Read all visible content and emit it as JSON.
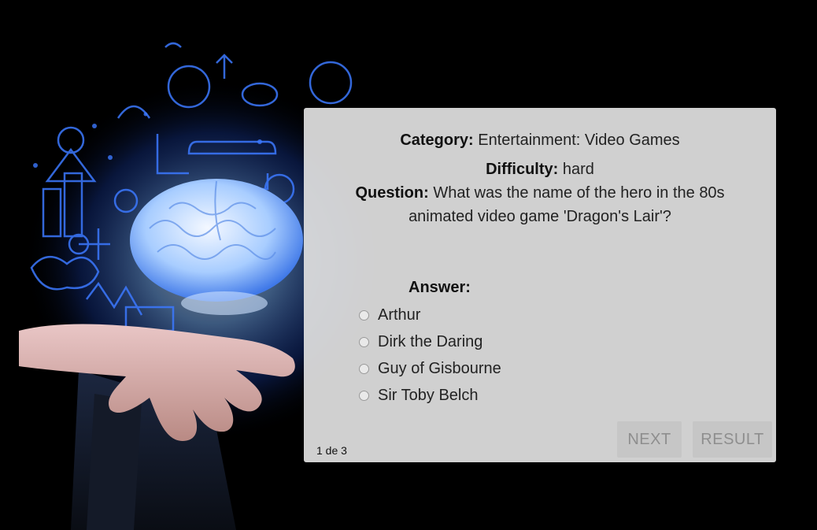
{
  "quiz": {
    "category_label": "Category:",
    "category_value": "Entertainment: Video Games",
    "difficulty_label": "Difficulty:",
    "difficulty_value": "hard",
    "question_label": "Question:",
    "question_text": "What was the name of the hero in the 80s animated video game 'Dragon's Lair'?",
    "answer_label": "Answer:",
    "options": [
      "Arthur",
      "Dirk the Daring",
      "Guy of Gisbourne",
      "Sir Toby Belch"
    ],
    "counter": "1 de 3",
    "next_label": "NEXT",
    "result_label": "RESULT"
  },
  "colors": {
    "page_background": "#000000",
    "card_background": "#e0e0e0",
    "button_background": "#c6c6c6",
    "button_text": "#8e8e8e",
    "art_glow": "#2a6bff"
  },
  "background_icon": "hand-holding-brain-icon"
}
